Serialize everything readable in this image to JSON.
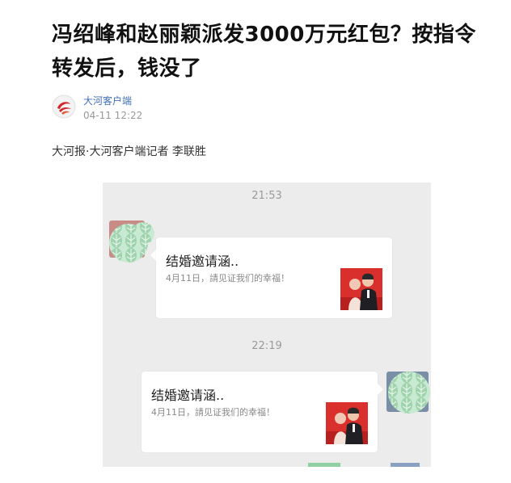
{
  "article": {
    "headline": "冯绍峰和赵丽颖派发3000万元红包？按指令转发后，钱没了",
    "source": {
      "name": "大河客户端",
      "time": "04-11   12:22",
      "logo_icon": "dahe-logo-icon"
    },
    "byline": "大河报·大河客户端记者 李联胜"
  },
  "chat_screenshot": {
    "messages": [
      {
        "time": "21:53",
        "side": "left",
        "card_title": "结婚邀请涵..",
        "card_desc": "4月11日，請见证我们的幸福！",
        "thumb_icon": "wedding-photo-icon"
      },
      {
        "time": "22:19",
        "side": "right",
        "card_title": "结婚邀请涵..",
        "card_desc": "4月11日，請见证我们的幸福！",
        "thumb_icon": "wedding-photo-icon"
      }
    ]
  },
  "colors": {
    "source_link": "#3f6fb5",
    "logo_red": "#d4262a",
    "chat_bg": "#ececec",
    "mosaic_green": "#a8d8b4"
  }
}
